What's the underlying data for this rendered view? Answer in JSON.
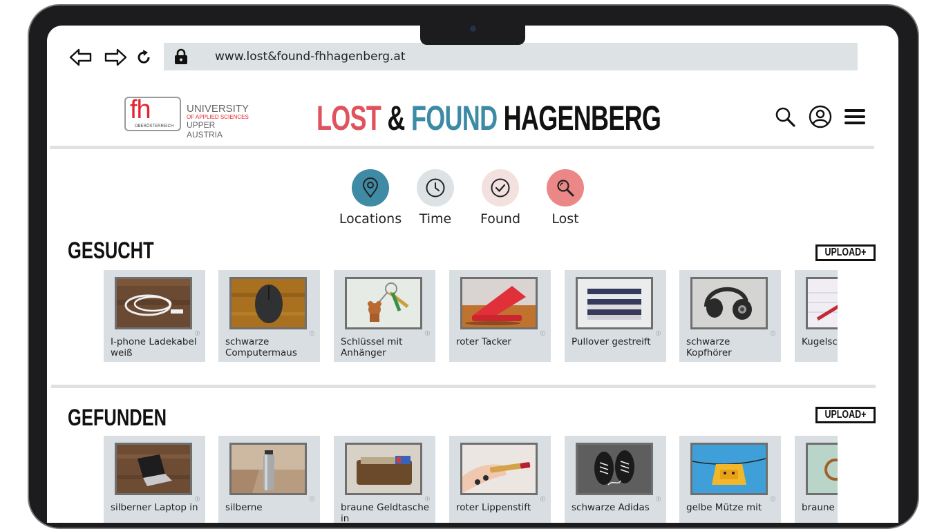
{
  "browser": {
    "back_icon": "arrow-left-icon",
    "forward_icon": "arrow-right-icon",
    "reload_icon": "reload-icon",
    "lock_icon": "lock-icon",
    "url": "www.lost&found-fhhagenberg.at"
  },
  "logo": {
    "mark": "fh",
    "sub": "OBERÖSTERREICH",
    "line1": "UNIVERSITY",
    "line2": "OF APPLIED SCIENCES",
    "line3": "UPPER AUSTRIA"
  },
  "title": {
    "lost": "LOST",
    "amp": " & ",
    "found": "FOUND",
    "hagenberg": " HAGENBERG"
  },
  "header_icons": [
    "search-icon",
    "user-icon",
    "menu-icon"
  ],
  "filters": [
    {
      "label": "Locations",
      "icon": "location-pin-icon",
      "color": "#3f8aa4"
    },
    {
      "label": "Time",
      "icon": "clock-icon",
      "color": "#dde2e5"
    },
    {
      "label": "Found",
      "icon": "check-circle-icon",
      "color": "#f3e1df"
    },
    {
      "label": "Lost",
      "icon": "search-icon",
      "color": "#ec8787"
    }
  ],
  "gesucht": {
    "title": "GESUCHT",
    "upload": "UPLOAD+",
    "items": [
      {
        "label": "I-phone Ladekabel weiß"
      },
      {
        "label": "schwarze Computermaus"
      },
      {
        "label": "Schlüssel mit Anhänger"
      },
      {
        "label": "roter Tacker"
      },
      {
        "label": "Pullover gestreift"
      },
      {
        "label": "schwarze Kopfhörer"
      },
      {
        "label": "Kugelschreiber"
      }
    ]
  },
  "gefunden": {
    "title": "GEFUNDEN",
    "upload": "UPLOAD+",
    "items": [
      {
        "label": "silberner Laptop in"
      },
      {
        "label": "silberne"
      },
      {
        "label": "braune Geldtasche in"
      },
      {
        "label": "roter Lippenstift"
      },
      {
        "label": "schwarze Adidas"
      },
      {
        "label": "gelbe Mütze mit"
      },
      {
        "label": "braune Brille"
      }
    ]
  },
  "colors": {
    "accent_red": "#e0535e",
    "accent_teal": "#3c8aa5",
    "card_bg": "#d8dee2"
  }
}
